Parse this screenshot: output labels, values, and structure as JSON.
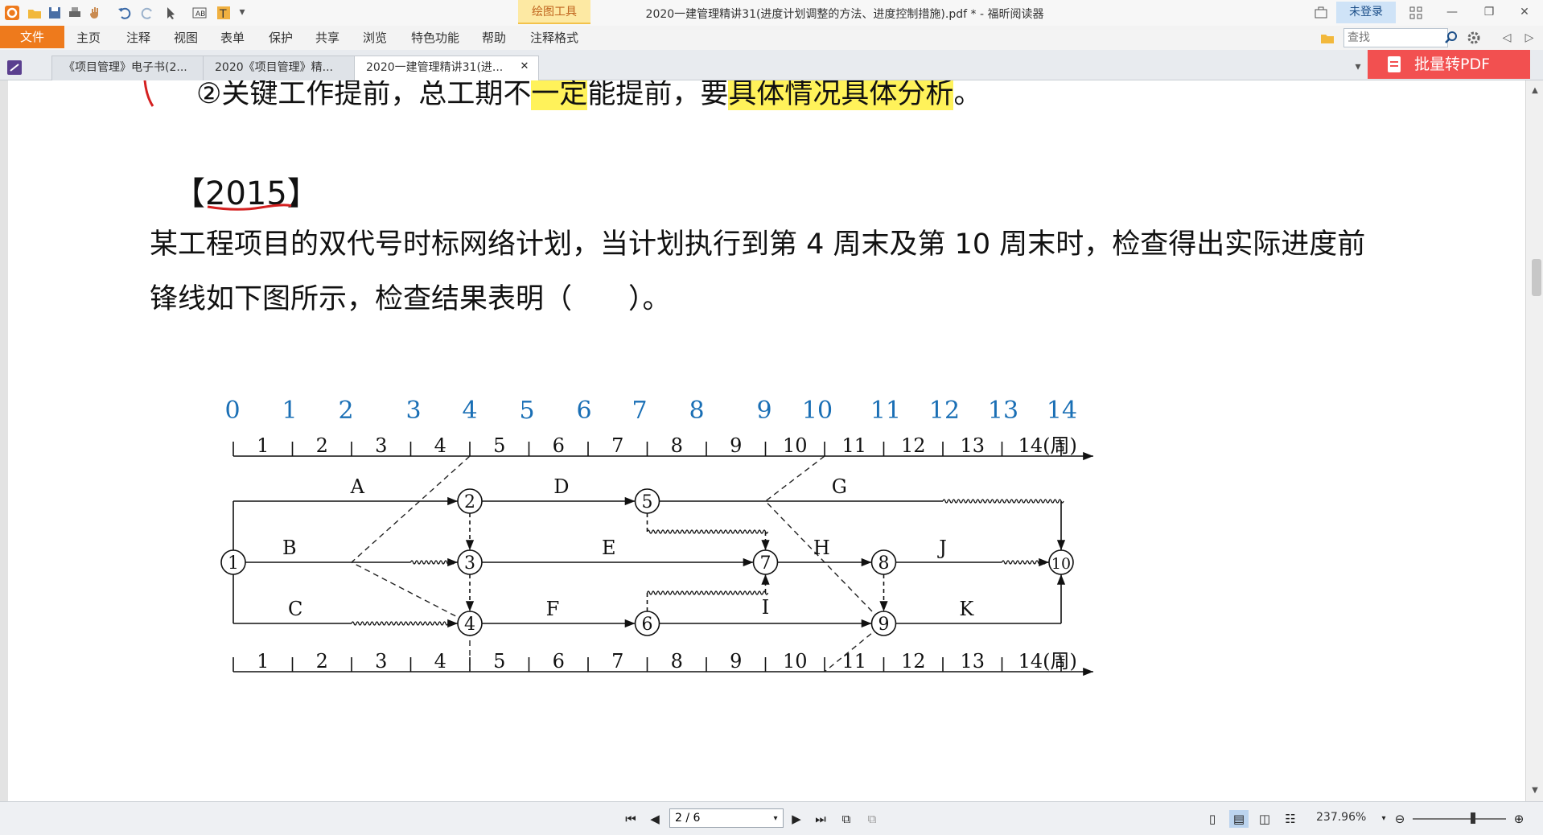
{
  "window": {
    "title": "2020一建管理精讲31(进度计划调整的方法、进度控制措施).pdf * - 福昕阅读器",
    "drawing_tools_tab": "绘图工具",
    "login": "未登录"
  },
  "menu": {
    "file": "文件",
    "items": [
      "主页",
      "注释",
      "视图",
      "表单",
      "保护",
      "共享",
      "浏览",
      "特色功能",
      "帮助",
      "注释格式"
    ],
    "search_placeholder": "查找"
  },
  "tabs": [
    {
      "label": "《项目管理》电子书(2..."
    },
    {
      "label": "2020《项目管理》精..."
    },
    {
      "label": "2020一建管理精讲31(进...",
      "active": true
    }
  ],
  "batch_convert": "批量转PDF",
  "document": {
    "clipped_line_start": "②关键工作提前，总工期不",
    "clipped_line_hl1": "一定",
    "clipped_line_mid": "能提前，要",
    "clipped_line_hl2": "具体情况具体分析",
    "clipped_line_end": "。",
    "year_tag": "【2015】",
    "question": "某工程项目的双代号时标网络计划，当计划执行到第 4 周末及第 10 周末时，检查得出实际进度前锋线如下图所示，检查结果表明（　　）。"
  },
  "diagram": {
    "annotated_numbers": [
      "0",
      "1",
      "2",
      "3",
      "4",
      "5",
      "6",
      "7",
      "8",
      "9",
      "10",
      "11",
      "12",
      "13",
      "14"
    ],
    "scale_labels": [
      "1",
      "2",
      "3",
      "4",
      "5",
      "6",
      "7",
      "8",
      "9",
      "10",
      "11",
      "12",
      "13",
      "14(周)"
    ],
    "nodes": [
      "1",
      "2",
      "3",
      "4",
      "5",
      "6",
      "7",
      "8",
      "9",
      "10"
    ],
    "activities": [
      "A",
      "B",
      "C",
      "D",
      "E",
      "F",
      "G",
      "H",
      "I",
      "J",
      "K"
    ],
    "annotation_color": "#1a6fb5"
  },
  "status": {
    "page": "2 / 6",
    "zoom": "237.96%"
  }
}
